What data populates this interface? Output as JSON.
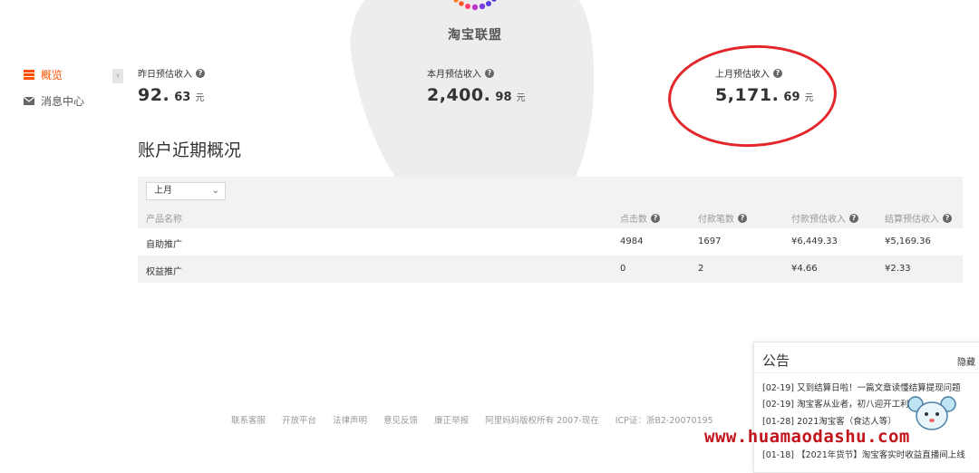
{
  "brand": {
    "name": "淘宝联盟"
  },
  "sidebar": {
    "items": [
      {
        "label": "概览",
        "icon": "overview-icon",
        "active": true
      },
      {
        "label": "消息中心",
        "icon": "mail-icon",
        "active": false
      }
    ],
    "collapse_icon": "chevron-left-icon"
  },
  "stats": {
    "yesterday": {
      "label": "昨日预估收入",
      "integer": "92.",
      "decimal": "63",
      "unit": "元"
    },
    "this_month": {
      "label": "本月预估收入",
      "integer": "2,400.",
      "decimal": "98",
      "unit": "元"
    },
    "last_month": {
      "label": "上月预估收入",
      "integer": "5,171.",
      "decimal": "69",
      "unit": "元"
    }
  },
  "overview": {
    "title": "账户近期概况",
    "period_select": "上月",
    "columns": [
      "产品名称",
      "点击数",
      "付款笔数",
      "付款预估收入",
      "结算预估收入"
    ],
    "rows": [
      {
        "name": "自助推广",
        "clicks": "4984",
        "orders": "1697",
        "paid_income": "¥6,449.33",
        "settled_income": "¥5,169.36"
      },
      {
        "name": "权益推广",
        "clicks": "0",
        "orders": "2",
        "paid_income": "¥4.66",
        "settled_income": "¥2.33"
      }
    ]
  },
  "footer": {
    "links": [
      "联系客服",
      "开放平台",
      "法律声明",
      "意见反馈",
      "廉正举报",
      "阿里妈妈版权所有 2007-现在",
      "ICP证：浙B2-20070195"
    ]
  },
  "notice": {
    "title": "公告",
    "hide_label": "隐藏",
    "items": [
      {
        "date": "[02-19]",
        "text": "又到结算日啦！一篇文章读懂结算提现问题"
      },
      {
        "date": "[02-19]",
        "text": "淘宝客从业者，初八迎开工利好"
      },
      {
        "date": "[01-28]",
        "text": "2021淘宝客（食达人等）"
      },
      {
        "date": "[01-18]",
        "text": "【2021年货节】淘宝客实时收益直播间上线"
      }
    ]
  },
  "watermark": "www.huamaodashu.com",
  "colors": {
    "accent": "#ff5000",
    "highlight_circle": "#e3262b",
    "watermark": "#c2151b"
  }
}
